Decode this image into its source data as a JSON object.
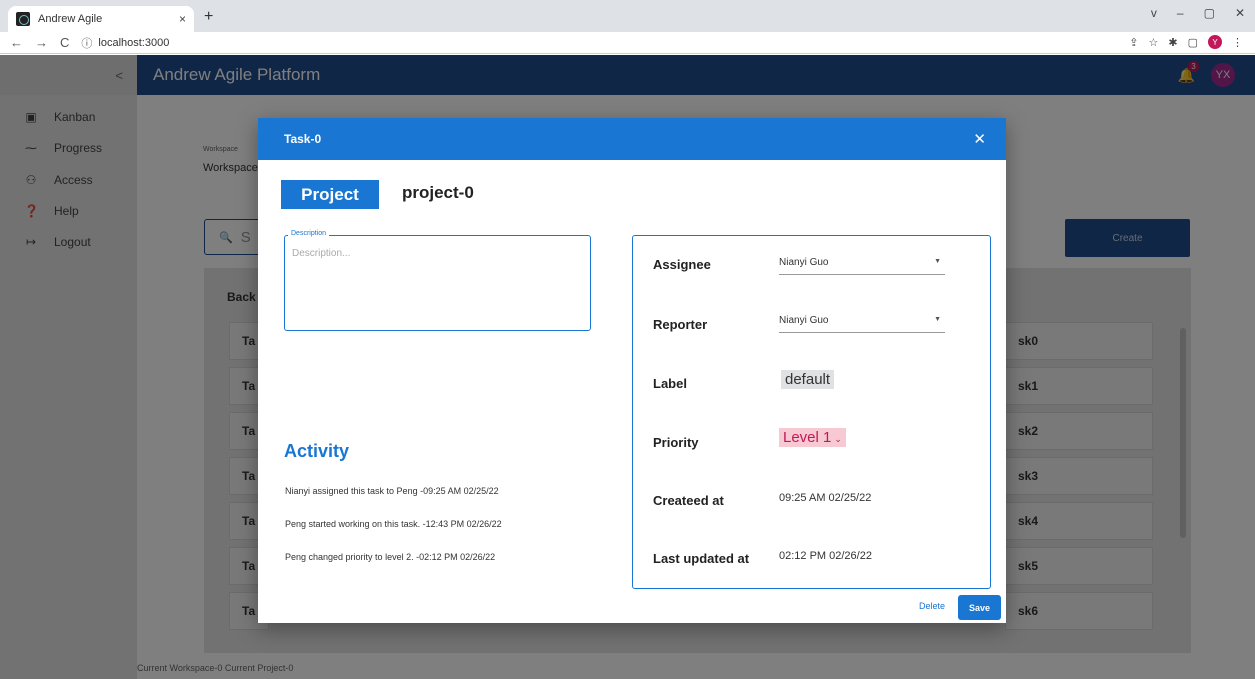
{
  "browser": {
    "tab_title": "Andrew Agile",
    "tab_close": "×",
    "new_tab": "+",
    "url": "localhost:3000",
    "controls": [
      "v",
      "–",
      "▢",
      "✕"
    ],
    "toolbar_icons": [
      "share-icon",
      "star-icon",
      "extensions-icon",
      "sidepanel-icon",
      "profile-icon",
      "menu-icon"
    ],
    "profile_initial": "Y"
  },
  "app": {
    "title": "Andrew Agile Platform",
    "notification_count": "3",
    "avatar_initials": "YX"
  },
  "sidebar": {
    "collapse_icon": "<",
    "items": [
      {
        "label": "Kanban",
        "icon": "kanban-icon"
      },
      {
        "label": "Progress",
        "icon": "progress-icon"
      },
      {
        "label": "Access",
        "icon": "people-icon"
      },
      {
        "label": "Help",
        "icon": "help-icon"
      },
      {
        "label": "Logout",
        "icon": "logout-icon"
      }
    ]
  },
  "main": {
    "workspace_label": "Workspace",
    "workspace_value": "Workspace",
    "search_placeholder": "S",
    "create_label": "Create",
    "column_head": "Back",
    "left_cards": [
      "Ta",
      "Ta",
      "Ta",
      "Ta",
      "Ta",
      "Ta",
      "Ta"
    ],
    "right_cards": [
      "sk0",
      "sk1",
      "sk2",
      "sk3",
      "sk4",
      "sk5",
      "sk6"
    ],
    "footer": "Current Workspace-0 Current Project-0"
  },
  "modal": {
    "title": "Task-0",
    "close": "✕",
    "project_tag": "Project",
    "project_name": "project-0",
    "description_label": "Description",
    "description_placeholder": "Description...",
    "activity_title": "Activity",
    "activity": [
      "Nianyi assigned this task to Peng -09:25 AM 02/25/22",
      "Peng started working on this task. -12:43 PM 02/26/22",
      "Peng changed priority to level 2. -02:12 PM 02/26/22"
    ],
    "details": {
      "assignee_label": "Assignee",
      "assignee_value": "Nianyi Guo",
      "reporter_label": "Reporter",
      "reporter_value": "Nianyi Guo",
      "label_label": "Label",
      "label_value": "default",
      "priority_label": "Priority",
      "priority_value": "Level 1",
      "created_label": "Createed at",
      "created_value": "09:25 AM 02/25/22",
      "updated_label": "Last updated at",
      "updated_value": "02:12 PM 02/26/22"
    },
    "delete_label": "Delete",
    "save_label": "Save"
  }
}
